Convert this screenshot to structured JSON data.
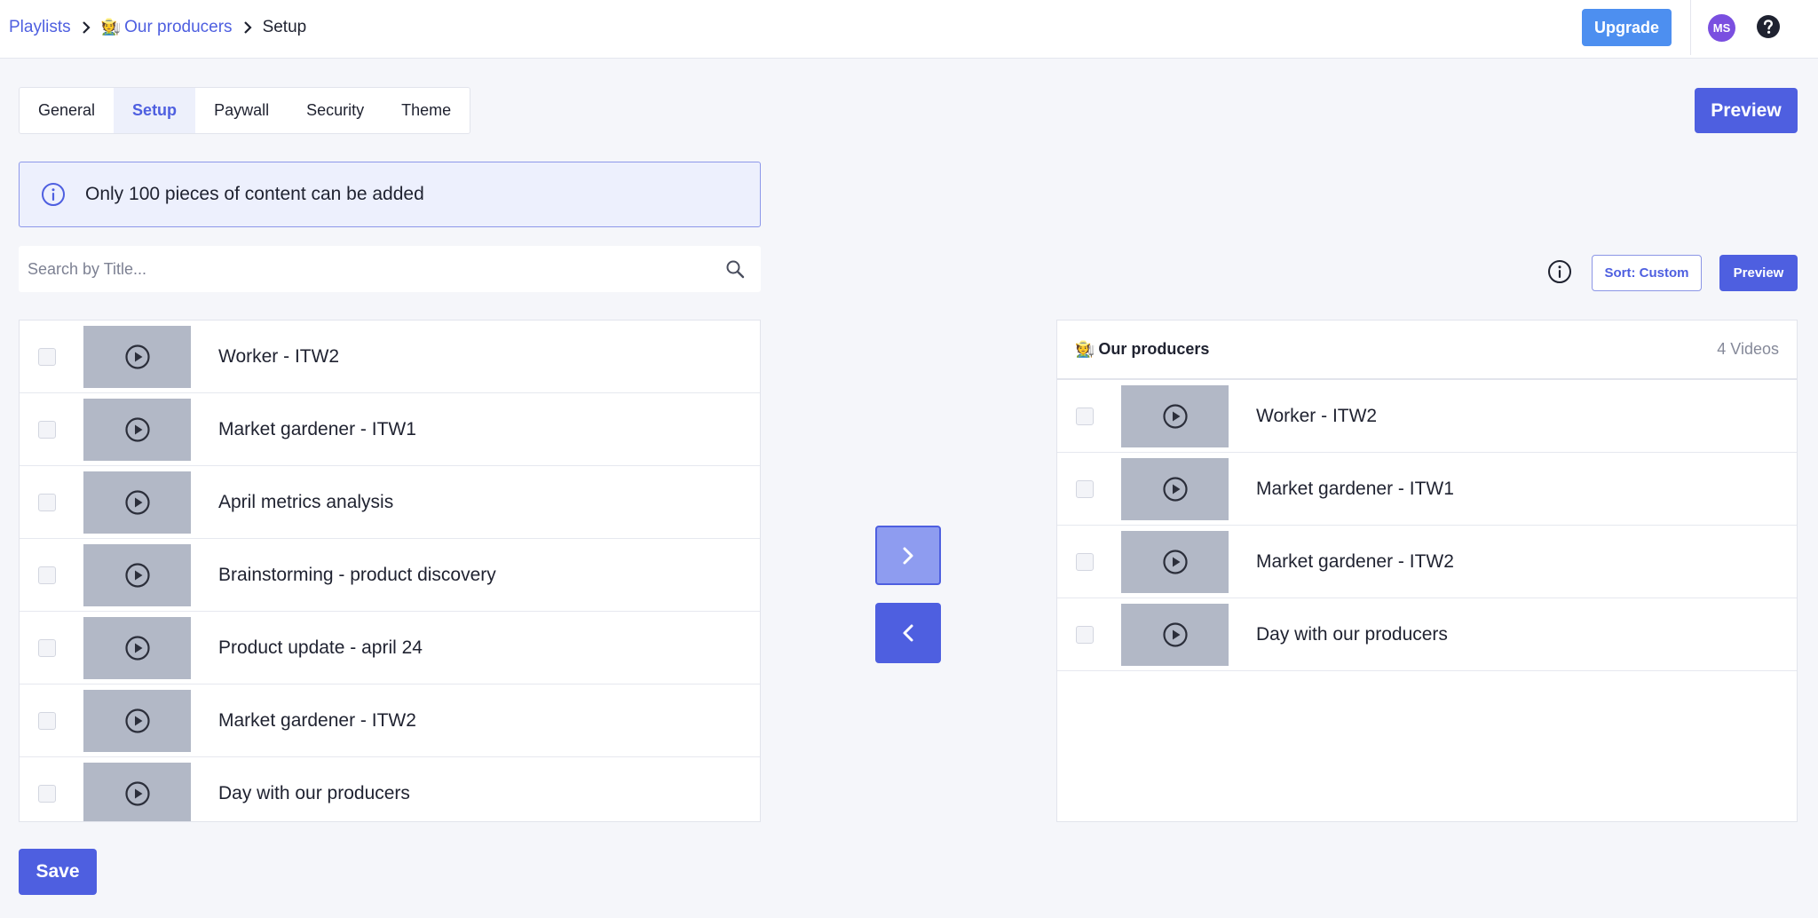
{
  "breadcrumb": {
    "items": [
      {
        "label": "Playlists"
      },
      {
        "emoji": "🧑‍🌾",
        "label": "Our producers"
      },
      {
        "label": "Setup"
      }
    ]
  },
  "header": {
    "upgrade_label": "Upgrade",
    "avatar_initials": "MS",
    "colors": {
      "upgrade": "#4d8ff0",
      "avatar": "#7a4fe0",
      "accent": "#4e5fe0"
    }
  },
  "tabs": [
    {
      "label": "General",
      "active": false
    },
    {
      "label": "Setup",
      "active": true
    },
    {
      "label": "Paywall",
      "active": false
    },
    {
      "label": "Security",
      "active": false
    },
    {
      "label": "Theme",
      "active": false
    }
  ],
  "preview_label": "Preview",
  "info_banner": {
    "text": "Only 100 pieces of content can be added"
  },
  "search": {
    "placeholder": "Search by Title...",
    "value": ""
  },
  "right_toolbar": {
    "sort_label": "Sort: Custom",
    "preview_label": "Preview"
  },
  "available_content": [
    {
      "title": "Worker - ITW2"
    },
    {
      "title": "Market gardener - ITW1"
    },
    {
      "title": "April metrics analysis"
    },
    {
      "title": "Brainstorming - product discovery"
    },
    {
      "title": "Product update - april 24"
    },
    {
      "title": "Market gardener - ITW2"
    },
    {
      "title": "Day with our producers"
    }
  ],
  "playlist": {
    "emoji": "🧑‍🌾",
    "title": "Our producers",
    "count_label": "4 Videos",
    "items": [
      {
        "title": "Worker - ITW2"
      },
      {
        "title": "Market gardener - ITW1"
      },
      {
        "title": "Market gardener - ITW2"
      },
      {
        "title": "Day with our producers"
      }
    ]
  },
  "save_label": "Save",
  "icons": {
    "breadcrumb_separator": "chevron-right-icon",
    "help": "help-circle-icon",
    "info": "info-icon",
    "search": "search-icon",
    "play": "play-circle-icon",
    "move_right": "chevron-right-icon",
    "move_left": "chevron-left-icon"
  }
}
